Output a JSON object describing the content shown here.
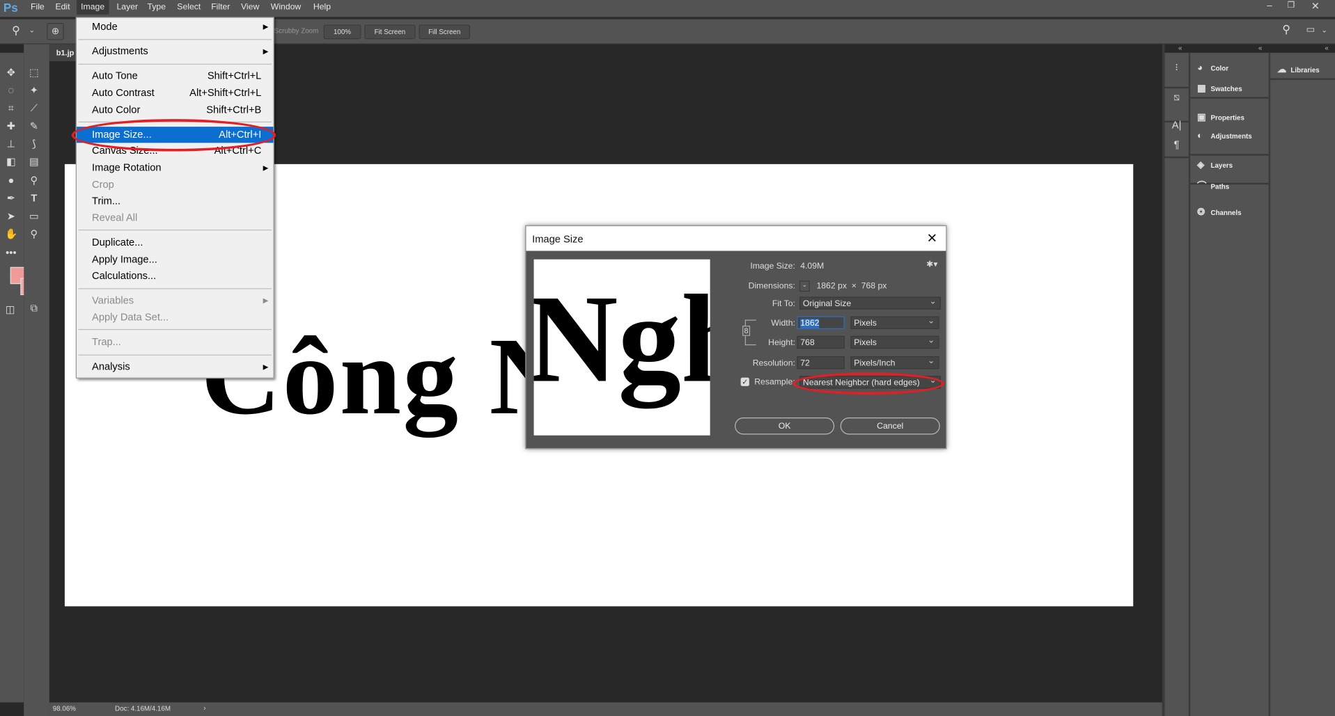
{
  "app": {
    "logo": "Ps",
    "document_tab": "b1.jp"
  },
  "menubar": [
    "File",
    "Edit",
    "Image",
    "Layer",
    "Type",
    "Select",
    "Filter",
    "View",
    "Window",
    "Help"
  ],
  "options_bar": {
    "scrubby_zoom": "Scrubby Zoom",
    "btn_100": "100%",
    "fit_screen": "Fit Screen",
    "fill_screen": "Fill Screen"
  },
  "image_menu": [
    {
      "label": "Mode",
      "submenu": true
    },
    {
      "sep": true
    },
    {
      "label": "Adjustments",
      "submenu": true
    },
    {
      "sep": true
    },
    {
      "label": "Auto Tone",
      "shortcut": "Shift+Ctrl+L"
    },
    {
      "label": "Auto Contrast",
      "shortcut": "Alt+Shift+Ctrl+L"
    },
    {
      "label": "Auto Color",
      "shortcut": "Shift+Ctrl+B"
    },
    {
      "sep": true
    },
    {
      "label": "Image Size...",
      "shortcut": "Alt+Ctrl+I",
      "selected": true
    },
    {
      "label": "Canvas Size...",
      "shortcut": "Alt+Ctrl+C"
    },
    {
      "label": "Image Rotation",
      "submenu": true
    },
    {
      "label": "Crop",
      "disabled": true
    },
    {
      "label": "Trim..."
    },
    {
      "label": "Reveal All",
      "disabled": true
    },
    {
      "sep": true
    },
    {
      "label": "Duplicate..."
    },
    {
      "label": "Apply Image..."
    },
    {
      "label": "Calculations..."
    },
    {
      "sep": true
    },
    {
      "label": "Variables",
      "submenu": true,
      "disabled": true
    },
    {
      "label": "Apply Data Set...",
      "disabled": true
    },
    {
      "sep": true
    },
    {
      "label": "Trap...",
      "disabled": true
    },
    {
      "sep": true
    },
    {
      "label": "Analysis",
      "submenu": true
    }
  ],
  "canvas": {
    "text": "Công N"
  },
  "dialog": {
    "title": "Image Size",
    "image_size_label": "Image Size:",
    "image_size_value": "4.09M",
    "dimensions_label": "Dimensions:",
    "dimensions_value": "1862 px  ×  768 px",
    "fit_to_label": "Fit To:",
    "fit_to_value": "Original Size",
    "width_label": "Width:",
    "width_value": "1862",
    "width_unit": "Pixels",
    "height_label": "Height:",
    "height_value": "768",
    "height_unit": "Pixels",
    "resolution_label": "Resolution:",
    "resolution_value": "72",
    "resolution_unit": "Pixels/Inch",
    "resample_label": "Resample:",
    "resample_checked": true,
    "resample_value": "Nearest Neighbcr (hard edges)",
    "preview_text": "Ngh",
    "ok": "OK",
    "cancel": "Cancel"
  },
  "panels": {
    "main": [
      {
        "icon": "palette-icon",
        "glyph": "◕",
        "label": "Color"
      },
      {
        "icon": "swatches-icon",
        "glyph": "▦",
        "label": "Swatches"
      },
      {
        "icon": "properties-icon",
        "glyph": "▣",
        "label": "Properties"
      },
      {
        "icon": "adjustments-icon",
        "glyph": "◐",
        "label": "Adjustments"
      },
      {
        "icon": "layers-icon",
        "glyph": "◈",
        "label": "Layers"
      },
      {
        "icon": "paths-icon",
        "glyph": "⌒",
        "label": "Paths"
      },
      {
        "icon": "channels-icon",
        "glyph": "❂",
        "label": "Channels"
      }
    ],
    "libraries": "Libraries"
  },
  "status": {
    "zoom": "98.06%",
    "doc": "Doc: 4.16M/4.16M"
  },
  "colors": {
    "foreground": "#f09a9a",
    "background": "#f4a6a6",
    "highlight": "#0a6fd0",
    "annotation": "#e31e24"
  }
}
